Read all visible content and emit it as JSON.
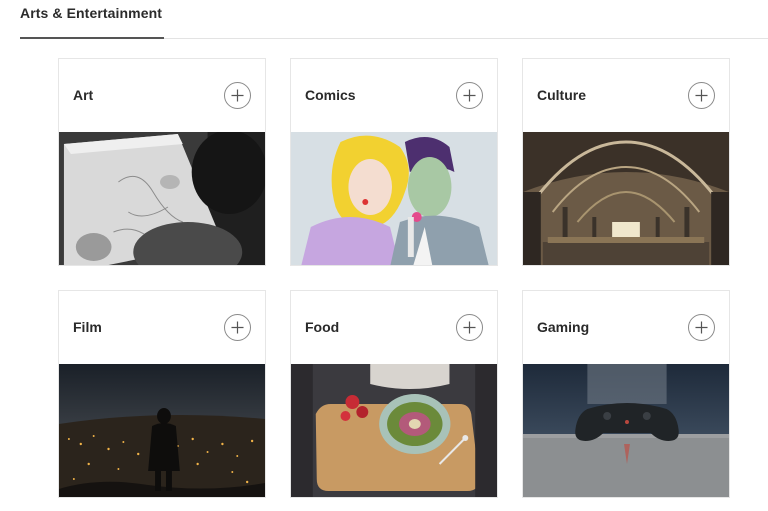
{
  "section": {
    "title": "Arts & Entertainment"
  },
  "cards": [
    {
      "label": "Art",
      "icon": "plus-icon"
    },
    {
      "label": "Comics",
      "icon": "plus-icon"
    },
    {
      "label": "Culture",
      "icon": "plus-icon"
    },
    {
      "label": "Film",
      "icon": "plus-icon"
    },
    {
      "label": "Food",
      "icon": "plus-icon"
    },
    {
      "label": "Gaming",
      "icon": "plus-icon"
    }
  ],
  "colors": {
    "border": "#e6e6e6",
    "text": "#2a2a2a",
    "icon": "#8a8a8a"
  }
}
